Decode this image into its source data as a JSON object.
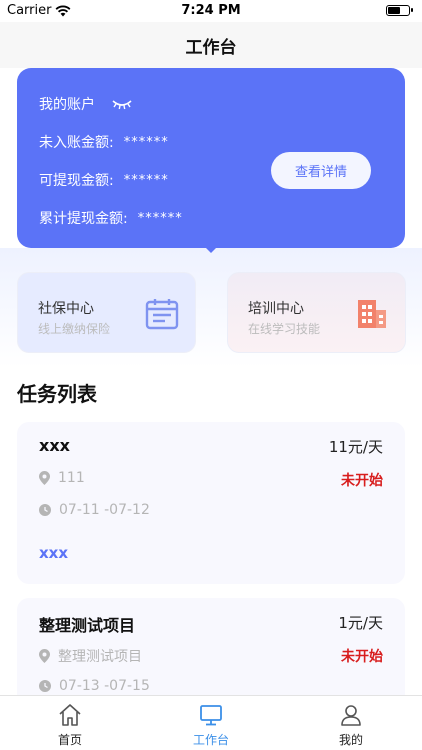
{
  "status_bar": {
    "carrier": "Carrier",
    "time": "7:24 PM"
  },
  "nav": {
    "title": "工作台"
  },
  "account": {
    "title": "我的账户",
    "rows": [
      {
        "label": "未入账金额:",
        "value": "******"
      },
      {
        "label": "可提现金额:",
        "value": "******"
      },
      {
        "label": "累计提现金额:",
        "value": "******"
      }
    ],
    "detail_button": "查看详情",
    "card_color": "#5b73f7"
  },
  "services": [
    {
      "name": "社保中心",
      "subtitle": "线上缴纳保险",
      "icon": "calendar-icon"
    },
    {
      "name": "培训中心",
      "subtitle": "在线学习技能",
      "icon": "building-icon"
    }
  ],
  "task_section": {
    "title": "任务列表"
  },
  "tasks": [
    {
      "name": "xxx",
      "price": "11元/天",
      "location": "111",
      "dates": "07-11  -07-12",
      "status": "未开始",
      "tag": "xxx"
    },
    {
      "name": "整理测试项目",
      "price": "1元/天",
      "location": "整理测试项目",
      "dates": "07-13  -07-15",
      "status": "未开始"
    }
  ],
  "tabbar": {
    "items": [
      {
        "label": "首页",
        "icon": "home-icon"
      },
      {
        "label": "工作台",
        "icon": "monitor-icon",
        "active": true
      },
      {
        "label": "我的",
        "icon": "user-icon"
      }
    ],
    "active_color": "#3b8fe8"
  }
}
